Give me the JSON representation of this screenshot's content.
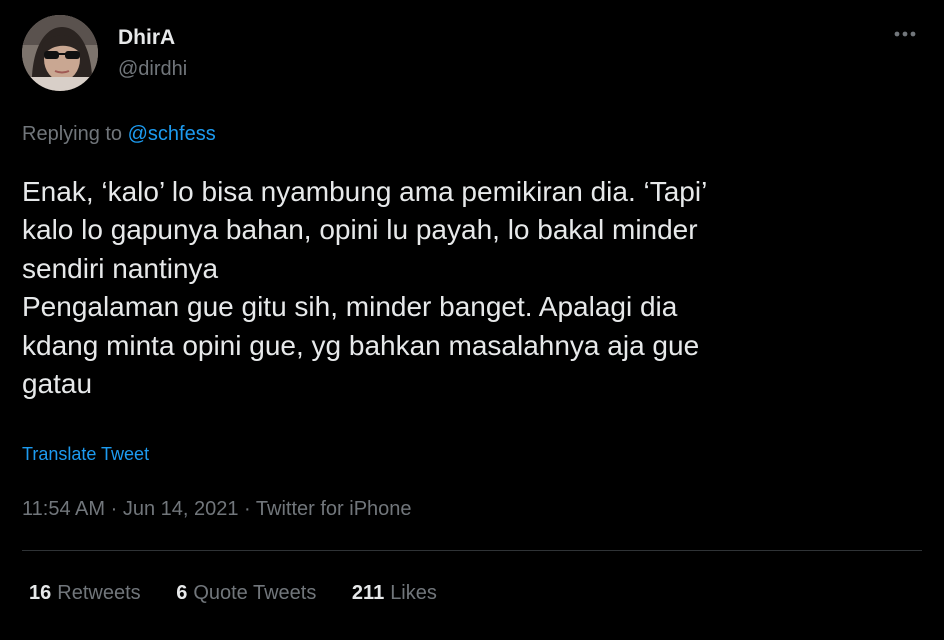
{
  "user": {
    "display_name": "DhirA",
    "handle": "@dirdhi"
  },
  "reply": {
    "prefix": "Replying to",
    "mention": "@schfess"
  },
  "tweet": {
    "lines": [
      "Enak, ‘kalo’ lo bisa nyambung ama pemikiran dia. ‘Tapi’",
      "kalo lo gapunya bahan, opini lu payah, lo bakal minder",
      "sendiri nantinya",
      "Pengalaman gue gitu sih, minder banget. Apalagi dia",
      "kdang minta opini gue, yg bahkan masalahnya aja gue",
      "gatau"
    ],
    "translate_label": "Translate Tweet"
  },
  "meta": {
    "time": "11:54 AM",
    "date": "Jun 14, 2021",
    "source": "Twitter for iPhone",
    "separator": "·"
  },
  "stats": {
    "retweets": {
      "count": "16",
      "label": "Retweets"
    },
    "quotes": {
      "count": "6",
      "label": "Quote Tweets"
    },
    "likes": {
      "count": "211",
      "label": "Likes"
    }
  },
  "icons": {
    "more": "more-horizontal-icon"
  },
  "colors": {
    "background": "#000000",
    "primary_text": "#e7e9ea",
    "secondary_text": "#71767b",
    "accent": "#1d9bf0",
    "divider": "#2f3336"
  }
}
